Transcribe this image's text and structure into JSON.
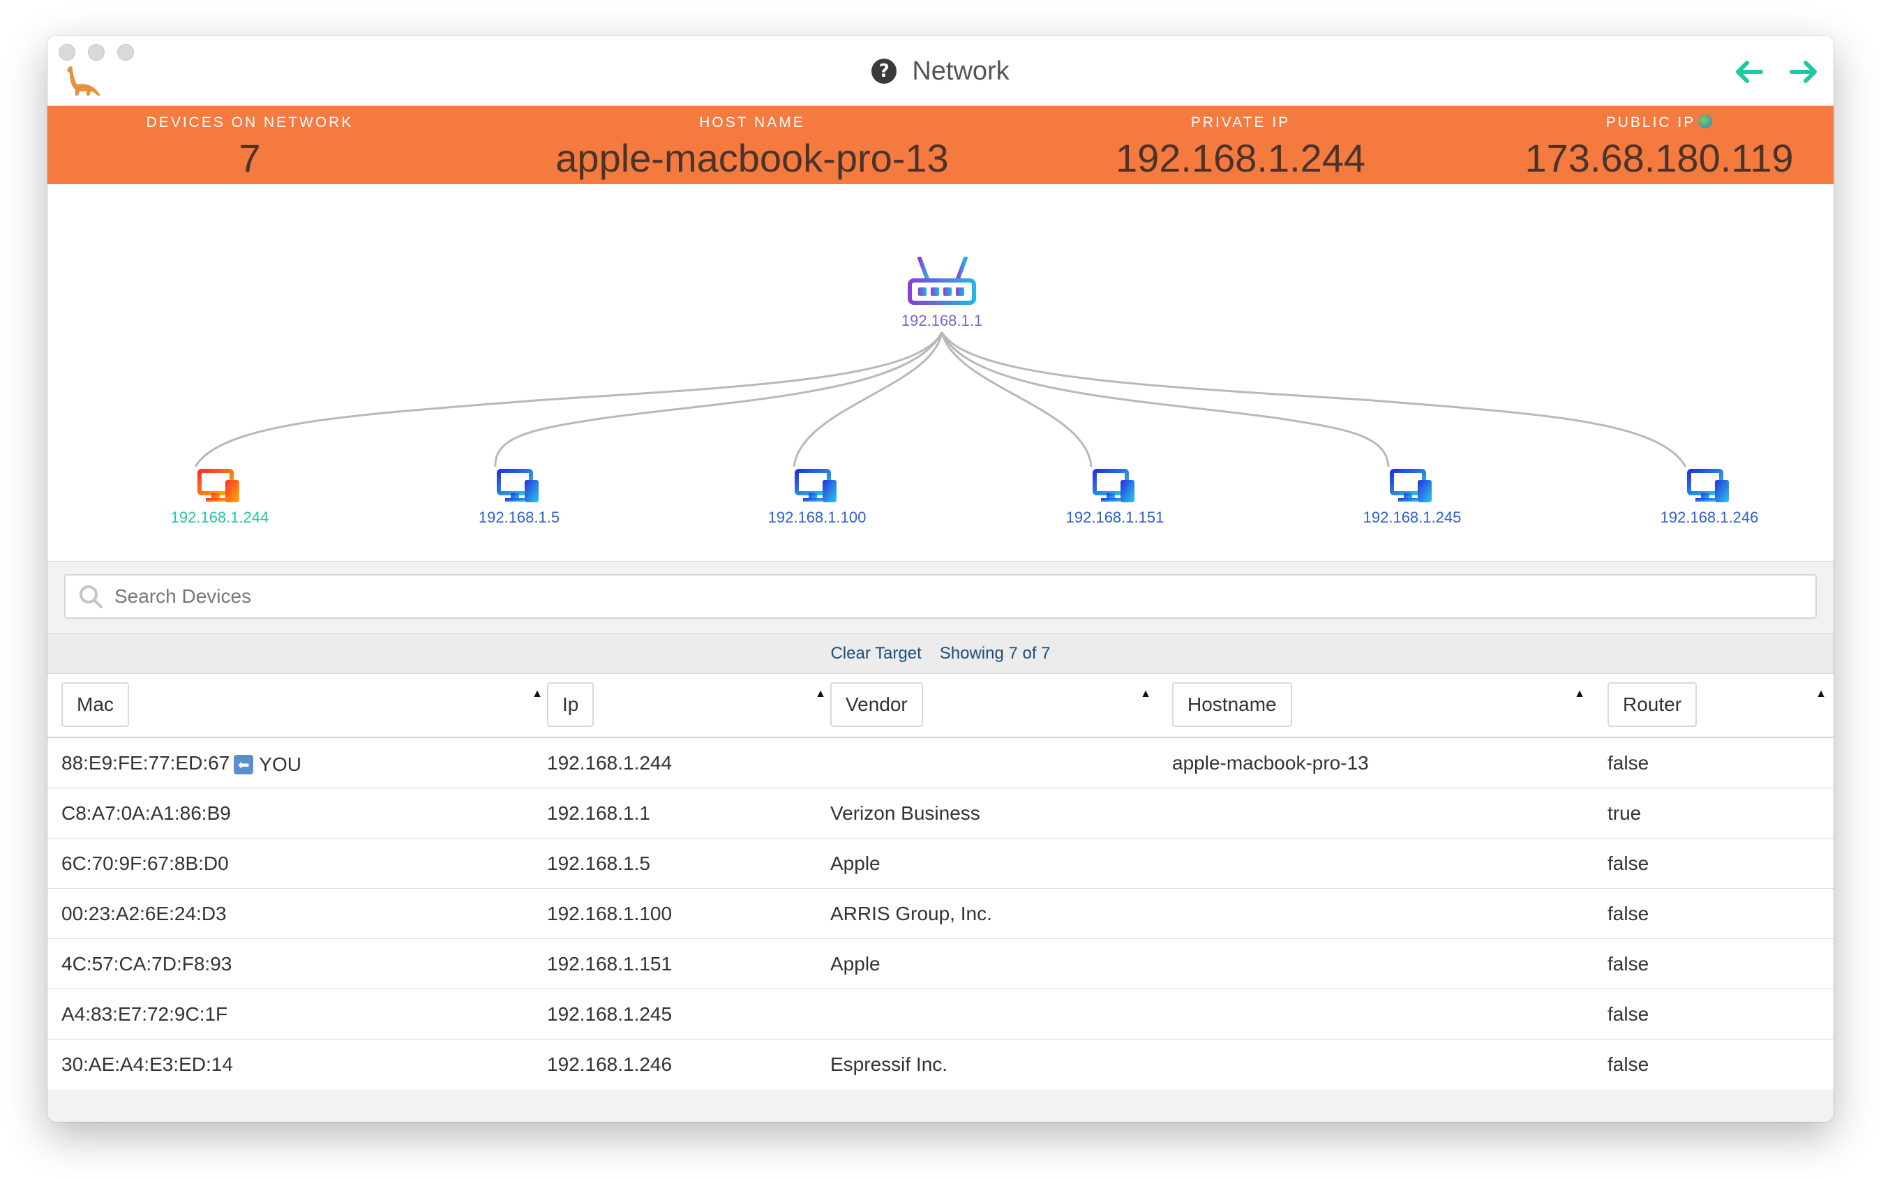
{
  "window": {
    "title": "Network"
  },
  "stats": {
    "devices_label": "DEVICES ON NETWORK",
    "devices_value": "7",
    "host_label": "HOST NAME",
    "host_value": "apple-macbook-pro-13",
    "private_label": "PRIVATE IP",
    "private_value": "192.168.1.244",
    "public_label": "PUBLIC IP",
    "public_value": "173.68.180.119"
  },
  "topology": {
    "router": "192.168.1.1",
    "devices": [
      {
        "ip": "192.168.1.244",
        "self": true
      },
      {
        "ip": "192.168.1.5"
      },
      {
        "ip": "192.168.1.100"
      },
      {
        "ip": "192.168.1.151"
      },
      {
        "ip": "192.168.1.245"
      },
      {
        "ip": "192.168.1.246"
      }
    ]
  },
  "search": {
    "placeholder": "Search Devices"
  },
  "filter": {
    "clear_label": "Clear Target",
    "showing_label": "Showing 7 of 7"
  },
  "table": {
    "columns": [
      "Mac",
      "Ip",
      "Vendor",
      "Hostname",
      "Router"
    ],
    "you_label": "YOU",
    "rows": [
      {
        "mac": "88:E9:FE:77:ED:67",
        "ip": "192.168.1.244",
        "vendor": "",
        "hostname": "apple-macbook-pro-13",
        "router": "false"
      },
      {
        "mac": "C8:A7:0A:A1:86:B9",
        "ip": "192.168.1.1",
        "vendor": "Verizon Business",
        "hostname": "",
        "router": "true"
      },
      {
        "mac": "6C:70:9F:67:8B:D0",
        "ip": "192.168.1.5",
        "vendor": "Apple",
        "hostname": "",
        "router": "false"
      },
      {
        "mac": "00:23:A2:6E:24:D3",
        "ip": "192.168.1.100",
        "vendor": "ARRIS Group, Inc.",
        "hostname": "",
        "router": "false"
      },
      {
        "mac": "4C:57:CA:7D:F8:93",
        "ip": "192.168.1.151",
        "vendor": "Apple",
        "hostname": "",
        "router": "false"
      },
      {
        "mac": "A4:83:E7:72:9C:1F",
        "ip": "192.168.1.245",
        "vendor": "",
        "hostname": "",
        "router": "false"
      },
      {
        "mac": "30:AE:A4:E3:ED:14",
        "ip": "192.168.1.246",
        "vendor": "Espressif Inc.",
        "hostname": "",
        "router": "false"
      }
    ]
  },
  "colors": {
    "accent_orange": "#f47a40",
    "nav_teal": "#1ec8a5",
    "link_blue": "#1f4e79"
  }
}
